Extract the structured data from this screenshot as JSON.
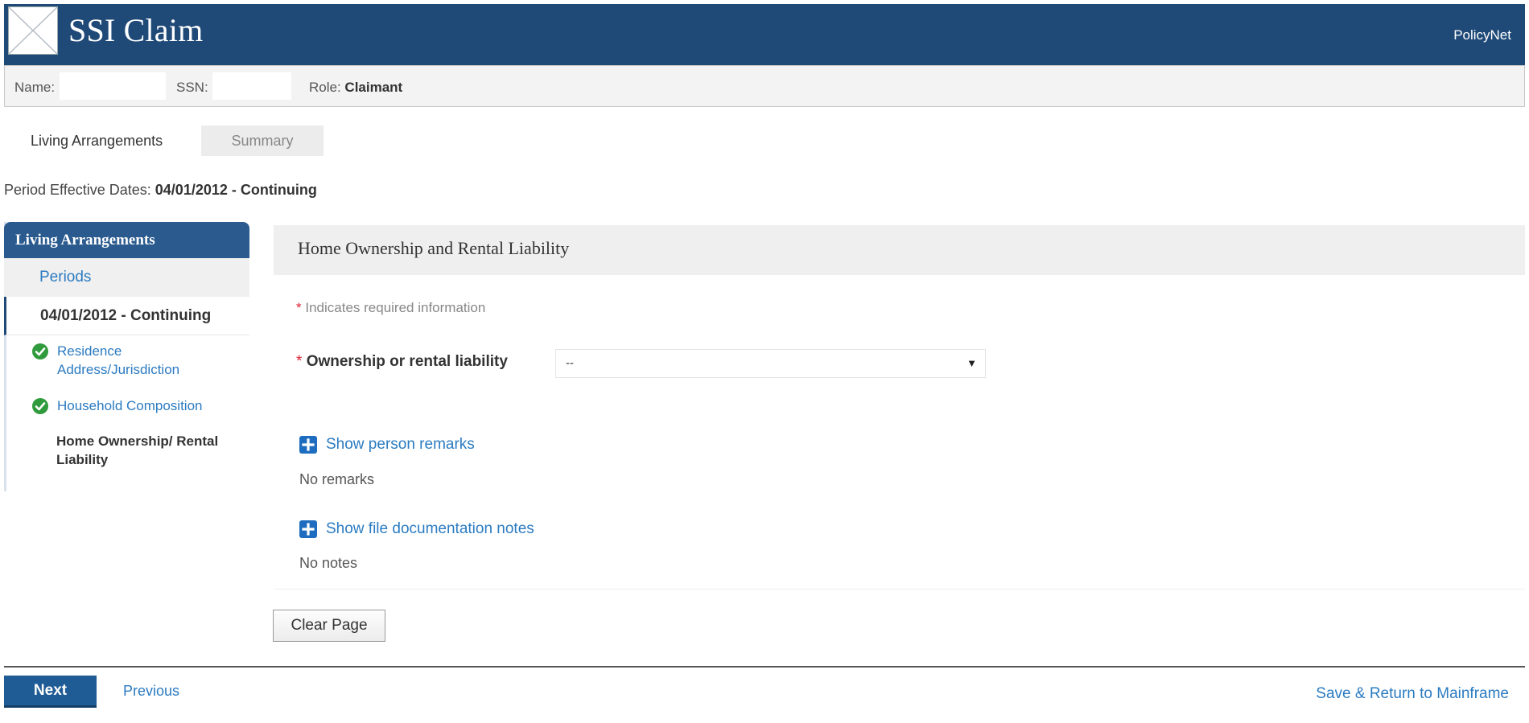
{
  "header": {
    "app_title": "SSI Claim",
    "policynet_link": "PolicyNet"
  },
  "claimant": {
    "name_label": "Name:",
    "ssn_label": "SSN:",
    "role_label": "Role:",
    "role_value": "Claimant"
  },
  "tabs": [
    {
      "label": "Living Arrangements",
      "active": true
    },
    {
      "label": "Summary",
      "active": false
    }
  ],
  "period": {
    "label": "Period Effective Dates:",
    "value": "04/01/2012 - Continuing"
  },
  "sidebar": {
    "heading": "Living Arrangements",
    "periods_link": "Periods",
    "current_period": "04/01/2012 - Continuing",
    "steps": [
      {
        "label": "Residence Address/Jurisdiction",
        "complete": true
      },
      {
        "label": "Household Composition",
        "complete": true
      },
      {
        "label": "Home Ownership/ Rental Liability",
        "complete": false,
        "current": true
      }
    ]
  },
  "panel": {
    "title": "Home Ownership and Rental Liability",
    "required_note": "Indicates required information",
    "ownership_label": "Ownership or rental liability",
    "ownership_value": "--",
    "show_remarks": "Show person remarks",
    "no_remarks": "No remarks",
    "show_notes": "Show file documentation notes",
    "no_notes": "No notes",
    "clear_button": "Clear Page"
  },
  "footer": {
    "next_button": "Next",
    "previous_link": "Previous",
    "save_link": "Save & Return to Mainframe"
  },
  "colors": {
    "header_bg": "#1f4a78",
    "link": "#2b7bc1",
    "check": "#2f9b3c",
    "required_star": "#d23"
  }
}
